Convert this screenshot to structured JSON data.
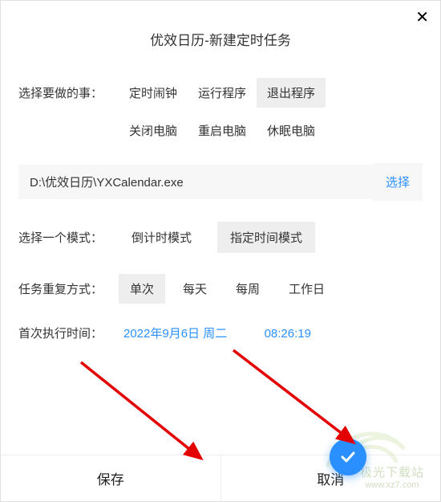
{
  "title": "优效日历-新建定时任务",
  "close_symbol": "✕",
  "task_type": {
    "label": "选择要做的事：",
    "row1": [
      "定时闹钟",
      "运行程序",
      "退出程序"
    ],
    "row2": [
      "关闭电脑",
      "重启电脑",
      "休眠电脑"
    ],
    "selected": "退出程序"
  },
  "path": {
    "value": "D:\\优效日历\\YXCalendar.exe",
    "choose_label": "选择"
  },
  "mode": {
    "label": "选择一个模式：",
    "options": [
      "倒计时模式",
      "指定时间模式"
    ],
    "selected": "指定时间模式"
  },
  "repeat": {
    "label": "任务重复方式：",
    "options": [
      "单次",
      "每天",
      "每周",
      "工作日"
    ],
    "selected": "单次"
  },
  "first_run": {
    "label": "首次执行时间：",
    "date": "2022年9月6日 周二",
    "time": "08:26:19"
  },
  "bottom": {
    "save": "保存",
    "cancel": "取消"
  },
  "watermark": {
    "line1": "极光下载站",
    "line2": "www.xz7.com"
  }
}
